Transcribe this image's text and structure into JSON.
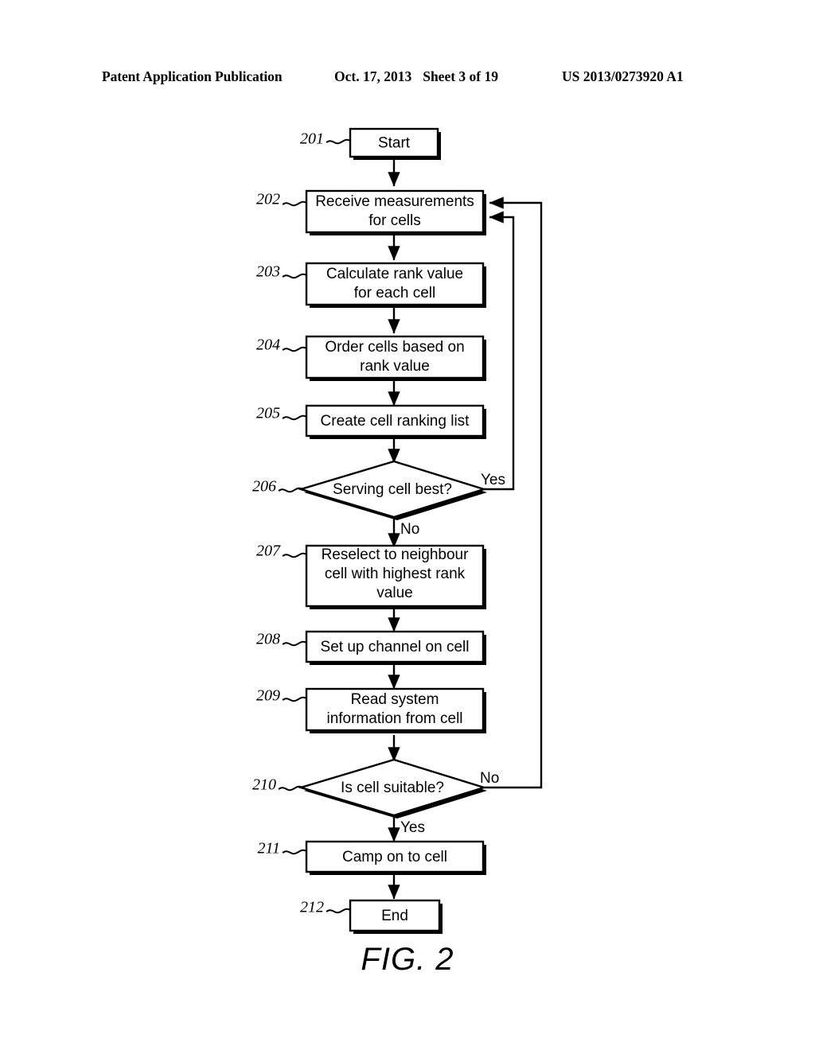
{
  "header": {
    "publication": "Patent Application Publication",
    "date": "Oct. 17, 2013",
    "sheet": "Sheet 3 of 19",
    "docnum": "US 2013/0273920 A1"
  },
  "figure": {
    "caption": "FIG. 2",
    "nodes": [
      {
        "ref": "201",
        "label_lines": [
          "Start"
        ],
        "shape": "process"
      },
      {
        "ref": "202",
        "label_lines": [
          "Receive measurements",
          "for cells"
        ],
        "shape": "process"
      },
      {
        "ref": "203",
        "label_lines": [
          "Calculate rank value",
          "for each cell"
        ],
        "shape": "process"
      },
      {
        "ref": "204",
        "label_lines": [
          "Order cells based on",
          "rank value"
        ],
        "shape": "process"
      },
      {
        "ref": "205",
        "label_lines": [
          "Create cell ranking list"
        ],
        "shape": "process"
      },
      {
        "ref": "206",
        "label_lines": [
          "Serving cell best?"
        ],
        "shape": "decision"
      },
      {
        "ref": "207",
        "label_lines": [
          "Reselect to neighbour",
          "cell with highest rank",
          "value"
        ],
        "shape": "process"
      },
      {
        "ref": "208",
        "label_lines": [
          "Set up channel on cell"
        ],
        "shape": "process"
      },
      {
        "ref": "209",
        "label_lines": [
          "Read system",
          "information from cell"
        ],
        "shape": "process"
      },
      {
        "ref": "210",
        "label_lines": [
          "Is cell suitable?"
        ],
        "shape": "decision"
      },
      {
        "ref": "211",
        "label_lines": [
          "Camp on to cell"
        ],
        "shape": "process"
      },
      {
        "ref": "212",
        "label_lines": [
          "End"
        ],
        "shape": "process"
      }
    ],
    "edge_labels": {
      "d206_yes": "Yes",
      "d206_no": "No",
      "d210_no": "No",
      "d210_yes": "Yes"
    }
  },
  "colors": {
    "ink": "#000000",
    "paper": "#ffffff"
  }
}
